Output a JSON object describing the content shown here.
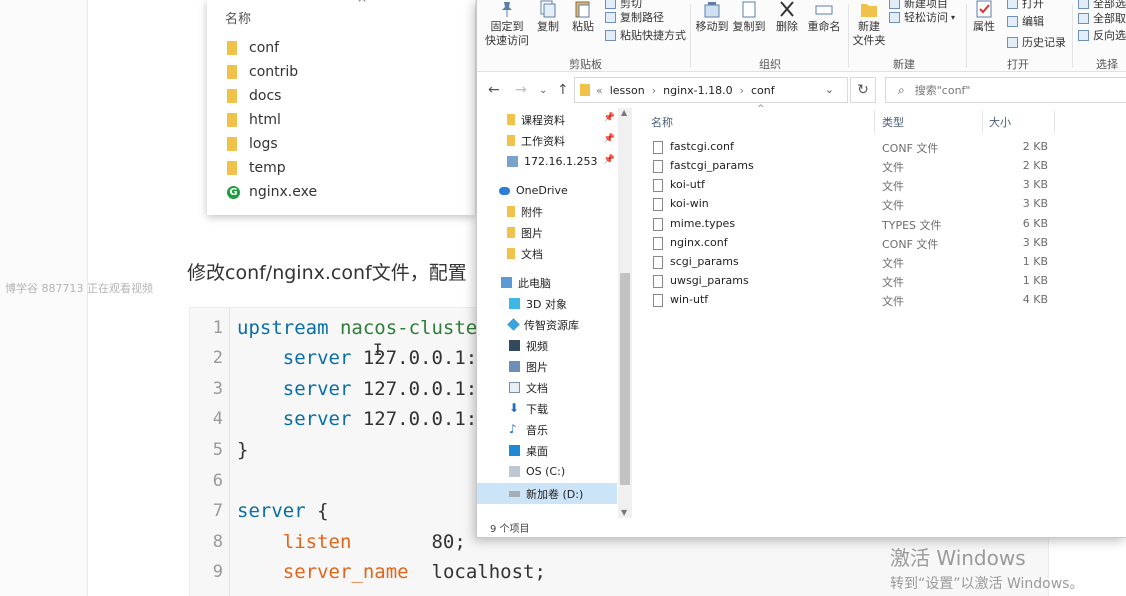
{
  "viewer_notice": "博学谷 887713 正在观看视频",
  "folder_card": {
    "header": "名称",
    "items": [
      {
        "name": "conf",
        "kind": "folder"
      },
      {
        "name": "contrib",
        "kind": "folder"
      },
      {
        "name": "docs",
        "kind": "folder"
      },
      {
        "name": "html",
        "kind": "folder"
      },
      {
        "name": "logs",
        "kind": "folder"
      },
      {
        "name": "temp",
        "kind": "folder"
      },
      {
        "name": "nginx.exe",
        "kind": "exe"
      }
    ]
  },
  "instruction": "修改conf/nginx.conf文件，配置",
  "code": {
    "line_numbers": [
      "1",
      "2",
      "3",
      "4",
      "5",
      "6",
      "7",
      "8",
      "9"
    ],
    "l1_kw": "upstream",
    "l1_id": "nacos-cluste",
    "l2_kw": "server",
    "l2_rest": "127.0.0.1:",
    "l3_kw": "server",
    "l3_rest": "127.0.0.1:",
    "l4_kw": "server",
    "l4_rest": "127.0.0.1:",
    "l5": "}",
    "l7_kw": "server",
    "l7_rest": "{",
    "l8_dir": "listen",
    "l8_val": "80;",
    "l9_dir": "server_name",
    "l9_val": "localhost;"
  },
  "windows_activation": {
    "title": "激活 Windows",
    "subtitle": "转到“设置”以激活 Windows。"
  },
  "explorer": {
    "ribbon": {
      "pin_quick_access": "固定到\n快速访问",
      "copy": "复制",
      "paste": "粘贴",
      "copy_path": "复制路径",
      "paste_shortcut": "粘贴快捷方式",
      "cut": "剪切",
      "move_to": "移动到",
      "copy_to": "复制到",
      "delete": "删除",
      "rename": "重命名",
      "new_folder": "新建\n文件夹",
      "new_item": "新建项目",
      "easy_access": "轻松访问",
      "properties": "属性",
      "open": "打开",
      "edit": "编辑",
      "history": "历史记录",
      "select_all": "全部选择",
      "select_none": "全部取消",
      "invert_selection": "反向选择",
      "group_clipboard": "剪贴板",
      "group_organize": "组织",
      "group_new": "新建",
      "group_open": "打开",
      "group_select": "选择"
    },
    "address": {
      "overflow": "«",
      "crumbs": [
        "lesson",
        "nginx-1.18.0",
        "conf"
      ],
      "search_placeholder": "搜索\"conf\""
    },
    "nav": [
      {
        "label": "课程资料",
        "icon": "folder",
        "pinned": true
      },
      {
        "label": "工作资料",
        "icon": "folder",
        "pinned": true
      },
      {
        "label": "172.16.1.253",
        "icon": "network-drive",
        "pinned": true
      },
      {
        "label": "OneDrive",
        "icon": "cloud"
      },
      {
        "label": "附件",
        "icon": "folder"
      },
      {
        "label": "图片",
        "icon": "folder"
      },
      {
        "label": "文档",
        "icon": "folder"
      },
      {
        "label": "此电脑",
        "icon": "computer"
      },
      {
        "label": "3D 对象",
        "icon": "cube"
      },
      {
        "label": "传智资源库",
        "icon": "library"
      },
      {
        "label": "视频",
        "icon": "video"
      },
      {
        "label": "图片",
        "icon": "picture"
      },
      {
        "label": "文档",
        "icon": "document"
      },
      {
        "label": "下载",
        "icon": "download"
      },
      {
        "label": "音乐",
        "icon": "music"
      },
      {
        "label": "桌面",
        "icon": "desktop"
      },
      {
        "label": "OS (C:)",
        "icon": "windows-drive"
      },
      {
        "label": "新加卷 (D:)",
        "icon": "drive",
        "selected": true
      }
    ],
    "columns": {
      "name": "名称",
      "type": "类型",
      "size": "大小"
    },
    "files": [
      {
        "name": "fastcgi.conf",
        "type": "CONF 文件",
        "size": "2 KB"
      },
      {
        "name": "fastcgi_params",
        "type": "文件",
        "size": "2 KB"
      },
      {
        "name": "koi-utf",
        "type": "文件",
        "size": "3 KB"
      },
      {
        "name": "koi-win",
        "type": "文件",
        "size": "3 KB"
      },
      {
        "name": "mime.types",
        "type": "TYPES 文件",
        "size": "6 KB"
      },
      {
        "name": "nginx.conf",
        "type": "CONF 文件",
        "size": "3 KB"
      },
      {
        "name": "scgi_params",
        "type": "文件",
        "size": "1 KB"
      },
      {
        "name": "uwsgi_params",
        "type": "文件",
        "size": "1 KB"
      },
      {
        "name": "win-utf",
        "type": "文件",
        "size": "4 KB"
      }
    ],
    "status": "9 个项目"
  }
}
